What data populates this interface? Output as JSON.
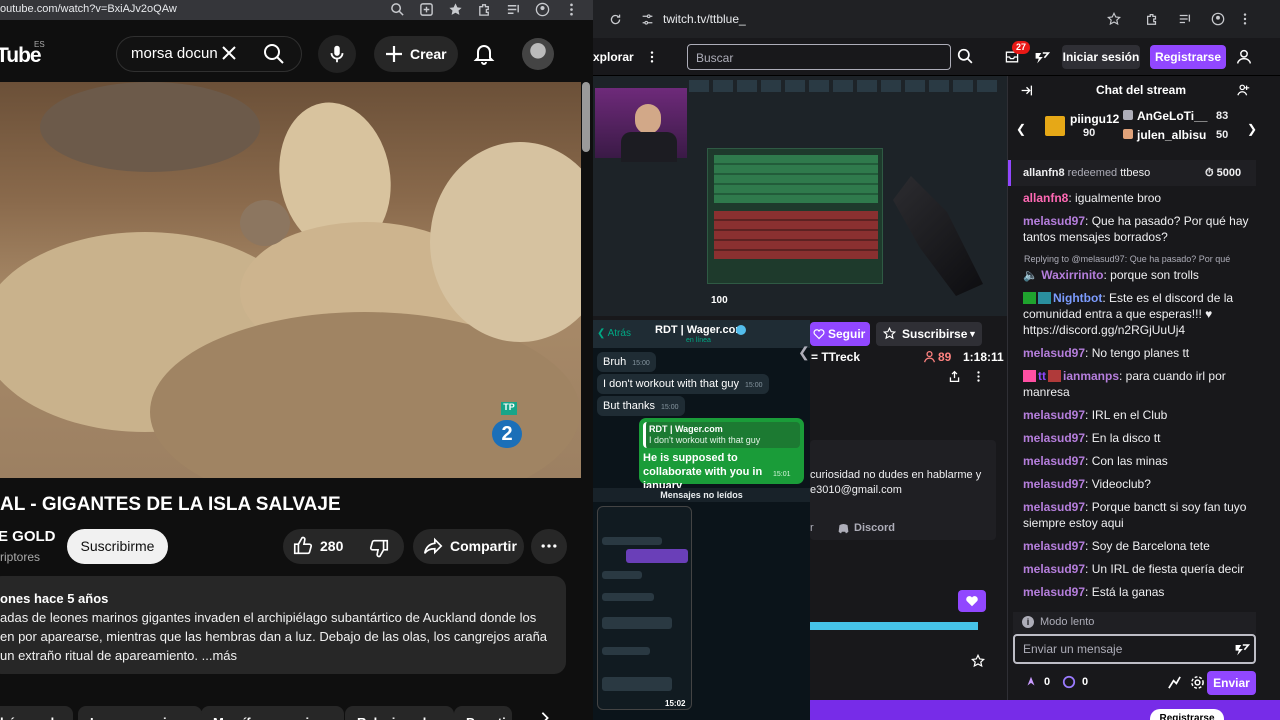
{
  "youtube": {
    "url": "outube.com/watch?v=BxiAJv2oQAw",
    "logo": "Tube",
    "logo_region": "ES",
    "search_value": "morsa docun",
    "create_label": "Crear",
    "video_title": "AL - GIGANTES DE LA ISLA SALVAJE",
    "channel_name": "E GOLD",
    "subscribers": "riptores",
    "subscribe_label": "Suscribirme",
    "likes": "280",
    "share_label": "Compartir",
    "desc_meta": "ones  hace 5 años",
    "desc_lines": [
      "adas de leones marinos gigantes invaden el archipiélago subantártico de Auckland donde los",
      "en por aparearse, mientras que las hembras dan a luz. Debajo de las olas, los cangrejos araña",
      " un extraño ritual de apareamiento. ...más"
    ],
    "chips": [
      "búsqueda",
      "Leones marinos",
      "Mamíferos marinos",
      "Relacionados",
      "Para ti"
    ],
    "video_badge_top": "TP",
    "video_badge_num": "2"
  },
  "twitch": {
    "url": "twitch.tv/ttblue_",
    "nav_explore": "xplorar",
    "search_placeholder": "Buscar",
    "notif_count": "27",
    "login_label": "Iniciar sesión",
    "register_label": "Registrarse",
    "follow_label": "Seguir",
    "subscribe_label": "Suscribirse",
    "stream_name": "= TTreck",
    "viewers": "89",
    "uptime": "1:18:11",
    "about_lines": [
      "curiosidad no dudes en hablarme y",
      "e3010@gmail.com"
    ],
    "discord_label": "Discord",
    "panel_prefix": "r",
    "bottom_button": "Registrarse",
    "hud_number": "100",
    "chat": {
      "title": "Chat del stream",
      "gifters": [
        {
          "name": "piingu12",
          "count": "90"
        },
        {
          "name": "AnGeLoTi__",
          "count": "83"
        },
        {
          "name": "julen_albisu",
          "count": "50"
        }
      ],
      "redeem_user": "allanfn8",
      "redeem_text": "redeemed",
      "redeem_reward": "ttbeso",
      "redeem_points": "5000",
      "reply_text": "Replying to @melasud97: Que ha pasado? Por qué",
      "messages": [
        {
          "user": "allanfn8",
          "text": ": igualmente broo",
          "color": "#ff69b4"
        },
        {
          "user": "melasud97",
          "text": ": Que ha pasado? Por qué hay tantos mensajes borrados?",
          "color": "#b57edc"
        },
        {
          "user": "Waxirrinito",
          "text": ": porque son trolls",
          "color": "#b57edc"
        },
        {
          "user": "Nightbot",
          "text": ": Este es el discord de la comunidad entra a que esperas!!! ♥ https://discord.gg/n2RGjUuUj4",
          "color": "#7c9cff"
        },
        {
          "user": "melasud97",
          "text": ": No tengo planes tt",
          "color": "#b57edc"
        },
        {
          "user": "ianmanps",
          "text": ": para cuando irl por manresa",
          "color": "#b57edc"
        },
        {
          "user": "melasud97",
          "text": ": IRL en el Club",
          "color": "#b57edc"
        },
        {
          "user": "melasud97",
          "text": ": En la disco tt",
          "color": "#b57edc"
        },
        {
          "user": "melasud97",
          "text": ": Con las minas",
          "color": "#b57edc"
        },
        {
          "user": "melasud97",
          "text": ": Videoclub?",
          "color": "#b57edc"
        },
        {
          "user": "melasud97",
          "text": ": Porque banctt si soy fan tuyo siempre estoy aqui",
          "color": "#b57edc"
        },
        {
          "user": "melasud97",
          "text": ": Soy de Barcelona tete",
          "color": "#b57edc"
        },
        {
          "user": "melasud97",
          "text": ": Un IRL de fiesta quería decir",
          "color": "#b57edc"
        },
        {
          "user": "melasud97",
          "text": ": Está la ganas",
          "color": "#b57edc"
        }
      ],
      "slow_mode": "Modo lento",
      "input_placeholder": "Enviar un mensaje",
      "points_a": "0",
      "points_b": "0",
      "send_label": "Enviar"
    }
  },
  "whatsapp": {
    "back_label": "Atrás",
    "contact": "RDT | Wager.com",
    "status": "en línea",
    "messages": [
      {
        "text": "Bruh",
        "time": "15:00"
      },
      {
        "text": "I don't workout with that guy",
        "time": "15:00"
      },
      {
        "text": "But thanks",
        "time": "15:00"
      }
    ],
    "quote_author": "RDT | Wager.com",
    "quote_text": "I don't workout with that guy",
    "reply_text": "He is supposed to collaborate with you in january",
    "reply_time": "15:01",
    "unread_label": "Mensajes no leídos",
    "phone_time": "15:02"
  }
}
